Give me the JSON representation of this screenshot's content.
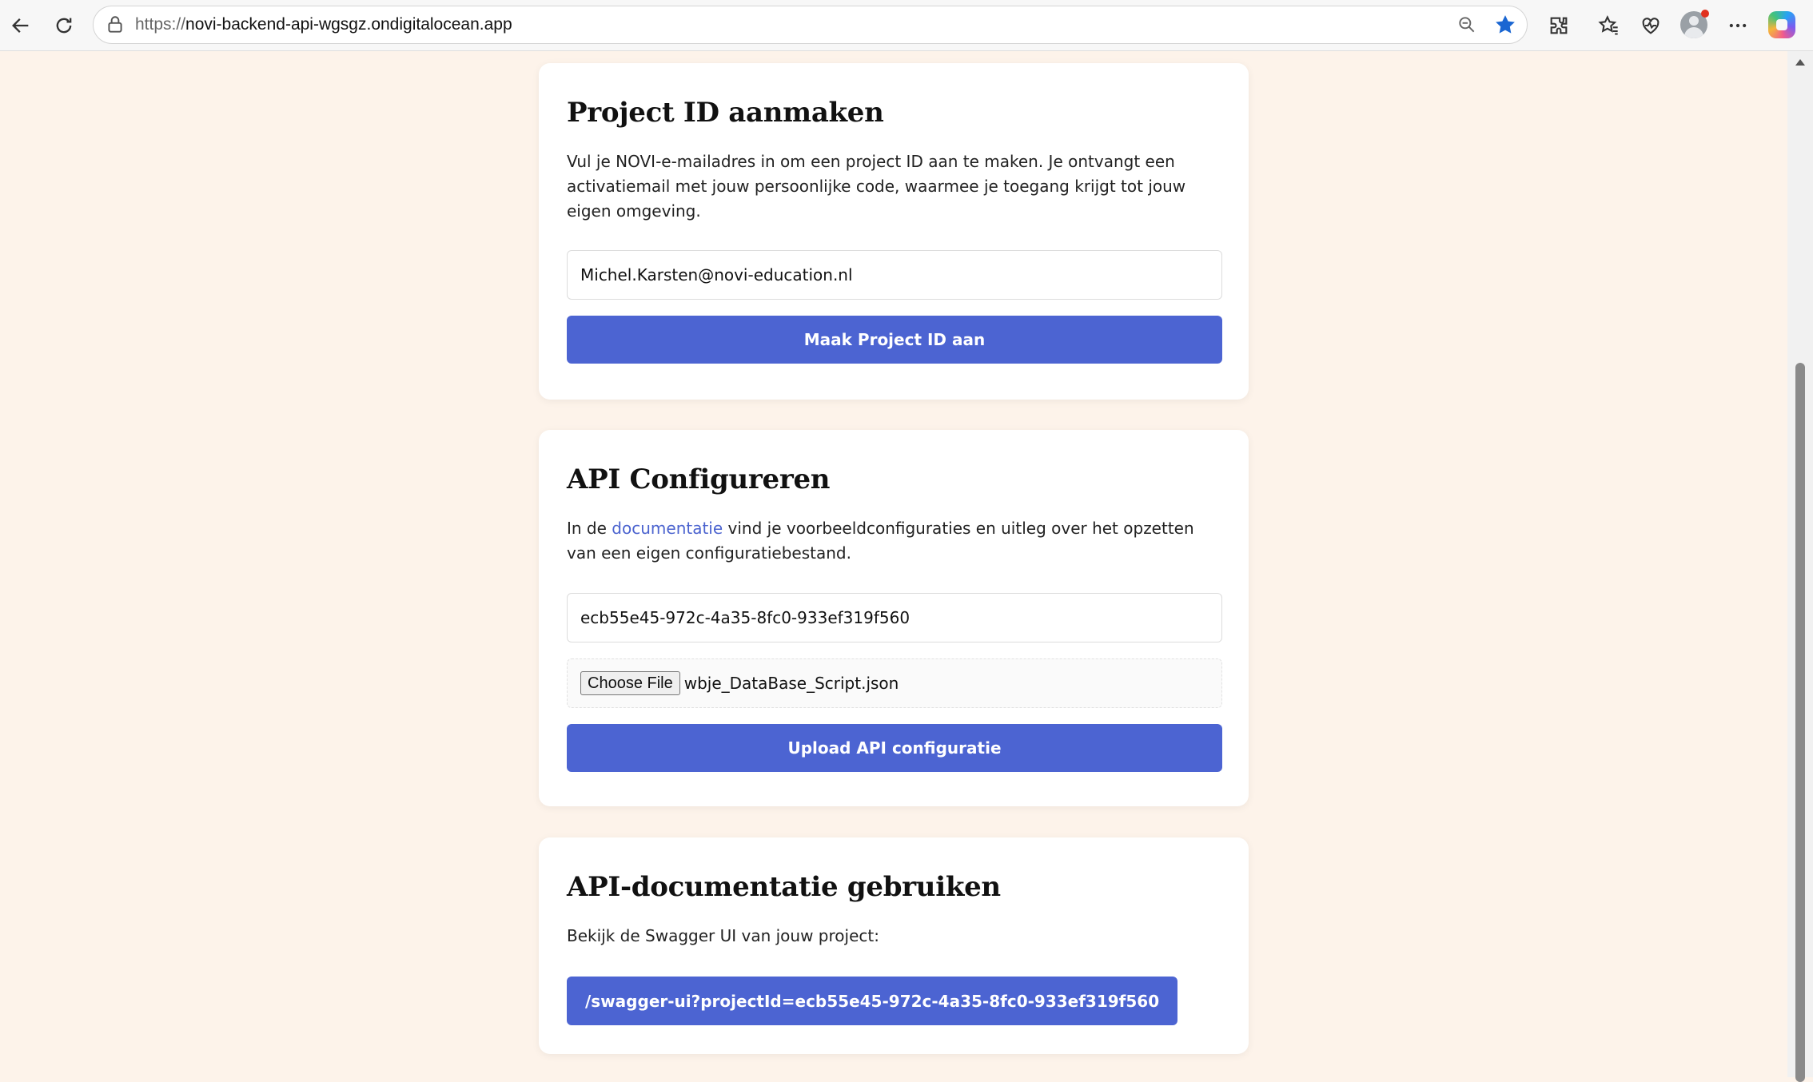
{
  "browser": {
    "url_scheme": "https://",
    "url_host": "novi-backend-api-wgsgz.ondigitalocean.app",
    "icons": [
      "back-icon",
      "reload-icon",
      "site-info-icon",
      "zoom-icon",
      "favorite-star-icon",
      "extensions-icon",
      "favorites-icon",
      "health-icon",
      "profile-avatar",
      "more-icon",
      "copilot-icon"
    ]
  },
  "create_project": {
    "title": "Project ID aanmaken",
    "description": "Vul je NOVI-e-mailadres in om een project ID aan te maken. Je ontvangt een activatiemail met jouw persoonlijke code, waarmee je toegang krijgt tot jouw eigen omgeving.",
    "email_value": "Michel.Karsten@novi-education.nl",
    "button_label": "Maak Project ID aan"
  },
  "configure_api": {
    "title": "API Configureren",
    "description_before": "In de ",
    "description_link": "documentatie",
    "description_after": " vind je voorbeeldconfiguraties en uitleg over het opzetten van een eigen configuratiebestand.",
    "project_id_value": "ecb55e45-972c-4a35-8fc0-933ef319f560",
    "file_button_label": "Choose File",
    "file_name": "wbje_DataBase_Script.json",
    "button_label": "Upload API configuratie"
  },
  "api_docs": {
    "title": "API-documentatie gebruiken",
    "description": "Bekijk de Swagger UI van jouw project:",
    "link_label": "/swagger-ui?projectId=ecb55e45-972c-4a35-8fc0-933ef319f560"
  },
  "colors": {
    "page_background": "#fdf3ea",
    "button": "#4c64d2",
    "link": "#4b63cf"
  }
}
